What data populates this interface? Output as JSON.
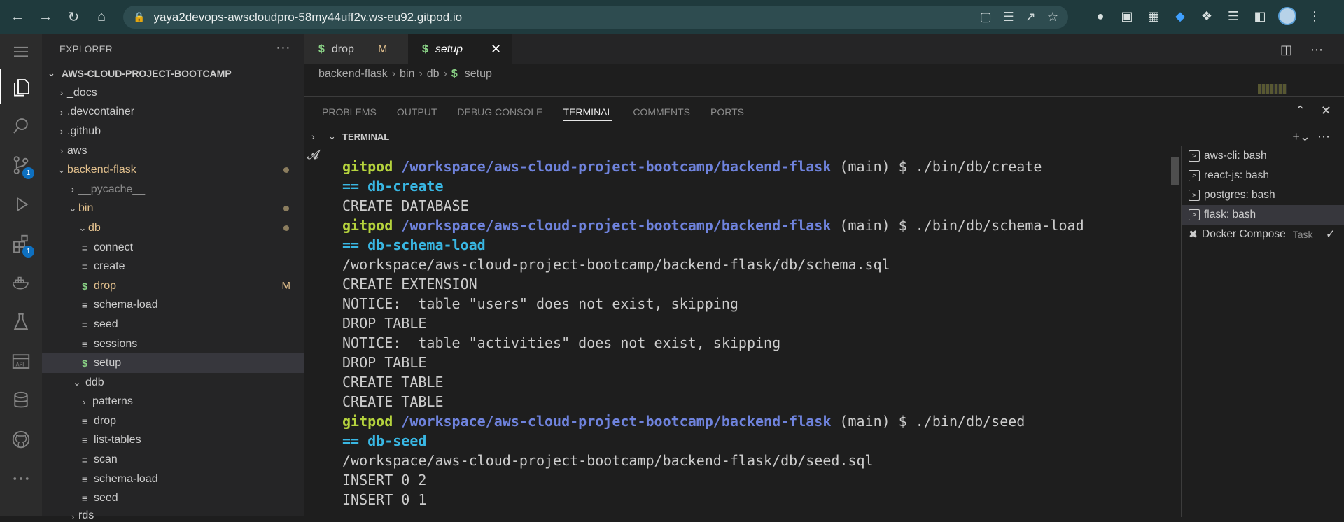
{
  "browser": {
    "url": "yaya2devops-awscloudpro-58my44uff2v.ws-eu92.gitpod.io"
  },
  "activity": {
    "source_control_badge": "1",
    "extensions_badge": "1"
  },
  "sidebar": {
    "title": "EXPLORER",
    "more": "···",
    "section": "AWS-CLOUD-PROJECT-BOOTCAMP",
    "items": [
      {
        "label": "_docs"
      },
      {
        "label": ".devcontainer"
      },
      {
        "label": ".github"
      },
      {
        "label": "aws"
      },
      {
        "label": "backend-flask"
      },
      {
        "label": "__pycache__"
      },
      {
        "label": "bin"
      },
      {
        "label": "db"
      },
      {
        "label": "connect"
      },
      {
        "label": "create"
      },
      {
        "label": "drop",
        "mark": "M"
      },
      {
        "label": "schema-load"
      },
      {
        "label": "seed"
      },
      {
        "label": "sessions"
      },
      {
        "label": "setup"
      },
      {
        "label": "ddb"
      },
      {
        "label": "patterns"
      },
      {
        "label": "drop"
      },
      {
        "label": "list-tables"
      },
      {
        "label": "scan"
      },
      {
        "label": "schema-load"
      },
      {
        "label": "seed"
      },
      {
        "label": "rds"
      }
    ]
  },
  "editor": {
    "tabs": [
      {
        "label": "drop",
        "status": "M"
      },
      {
        "label": "setup"
      }
    ],
    "breadcrumb": [
      "backend-flask",
      "bin",
      "db",
      "setup"
    ]
  },
  "panel": {
    "tabs": [
      "PROBLEMS",
      "OUTPUT",
      "DEBUG CONSOLE",
      "TERMINAL",
      "COMMENTS",
      "PORTS"
    ],
    "terminal_title": "TERMINAL",
    "terminal_lines": [
      {
        "kind": "prompt",
        "user": "gitpod",
        "path": "/workspace/aws-cloud-project-bootcamp/backend-flask",
        "rest": " (main) $ ./bin/db/create"
      },
      {
        "kind": "cyan",
        "text": "== db-create"
      },
      {
        "kind": "plain",
        "text": "CREATE DATABASE"
      },
      {
        "kind": "prompt",
        "user": "gitpod",
        "path": "/workspace/aws-cloud-project-bootcamp/backend-flask",
        "rest": " (main) $ ./bin/db/schema-load"
      },
      {
        "kind": "cyan",
        "text": "== db-schema-load"
      },
      {
        "kind": "plain",
        "text": "/workspace/aws-cloud-project-bootcamp/backend-flask/db/schema.sql"
      },
      {
        "kind": "plain",
        "text": "CREATE EXTENSION"
      },
      {
        "kind": "plain",
        "text": "NOTICE:  table \"users\" does not exist, skipping"
      },
      {
        "kind": "plain",
        "text": "DROP TABLE"
      },
      {
        "kind": "plain",
        "text": "NOTICE:  table \"activities\" does not exist, skipping"
      },
      {
        "kind": "plain",
        "text": "DROP TABLE"
      },
      {
        "kind": "plain",
        "text": "CREATE TABLE"
      },
      {
        "kind": "plain",
        "text": "CREATE TABLE"
      },
      {
        "kind": "prompt",
        "user": "gitpod",
        "path": "/workspace/aws-cloud-project-bootcamp/backend-flask",
        "rest": " (main) $ ./bin/db/seed"
      },
      {
        "kind": "cyan",
        "text": "== db-seed"
      },
      {
        "kind": "plain",
        "text": "/workspace/aws-cloud-project-bootcamp/backend-flask/db/seed.sql"
      },
      {
        "kind": "plain",
        "text": "INSERT 0 2"
      },
      {
        "kind": "plain",
        "text": "INSERT 0 1"
      }
    ],
    "terminals": [
      {
        "label": "aws-cli: bash"
      },
      {
        "label": "react-js: bash"
      },
      {
        "label": "postgres: bash"
      },
      {
        "label": "flask: bash"
      },
      {
        "label": "Docker Compose",
        "tag": "Task"
      }
    ]
  }
}
